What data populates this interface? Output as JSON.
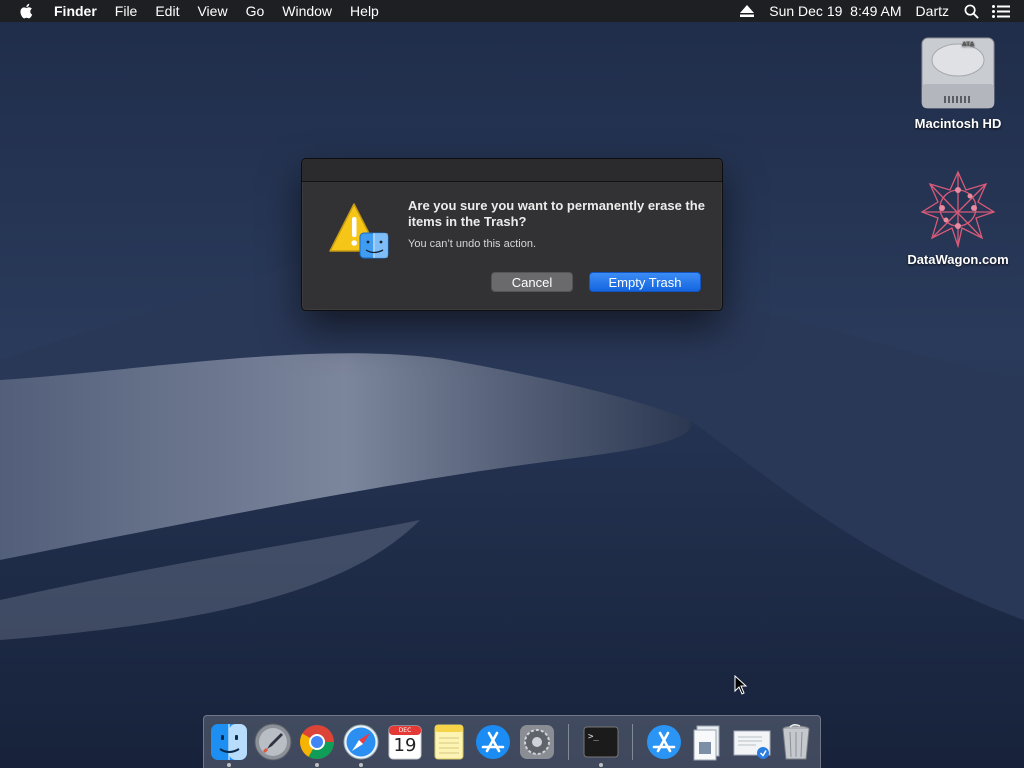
{
  "menubar": {
    "app_name": "Finder",
    "menus": [
      "File",
      "Edit",
      "View",
      "Go",
      "Window",
      "Help"
    ],
    "datetime": "Sun Dec 19  8:49 AM",
    "user": "Dartz"
  },
  "desktop": {
    "icons": [
      {
        "label": "Macintosh HD",
        "icon": "hard-drive-icon"
      },
      {
        "label": "DataWagon.com",
        "icon": "network-star-icon"
      }
    ]
  },
  "dialog": {
    "title": "Are you sure you want to permanently erase the items in the Trash?",
    "message": "You can’t undo this action.",
    "cancel_label": "Cancel",
    "confirm_label": "Empty Trash",
    "icon": "warning-finder-icon"
  },
  "dock": {
    "calendar_month": "DEC",
    "calendar_day": "19",
    "items": [
      "finder",
      "launchpad",
      "chrome",
      "safari",
      "calendar",
      "notes",
      "app-store",
      "system-preferences",
      "terminal",
      "app-store-downloads",
      "documents",
      "preview-file",
      "trash"
    ]
  },
  "colors": {
    "accent": "#1a6ae6",
    "dialog_bg": "#323234",
    "menubar_bg": "#1e1e20"
  }
}
